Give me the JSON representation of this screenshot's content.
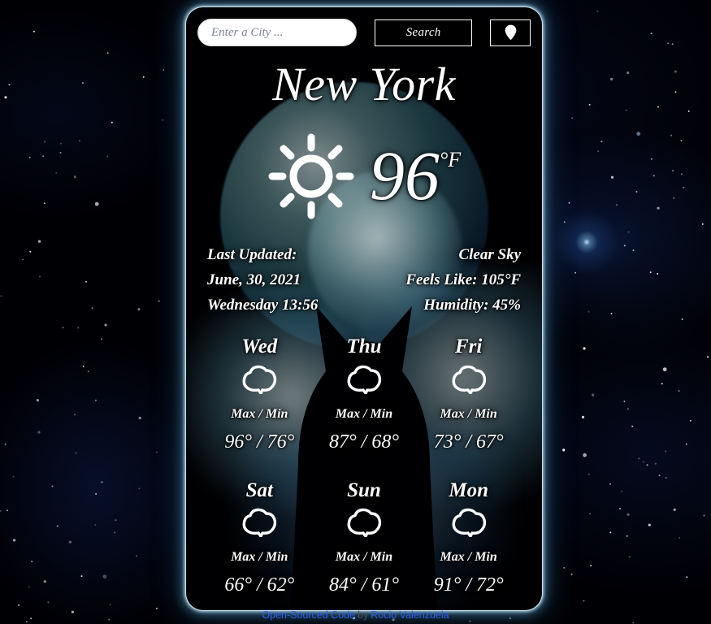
{
  "search": {
    "placeholder": "Enter a City ...",
    "value": "",
    "search_label": "Search",
    "location_icon": "map-pin-icon"
  },
  "current": {
    "city": "New York",
    "condition_icon": "sun-icon",
    "temperature": "96",
    "unit": "°F",
    "last_updated_label": "Last Updated:",
    "date": "June, 30, 2021",
    "weekday_time": "Wednesday 13:56",
    "description": "Clear Sky",
    "feels_like": "Feels Like: 105°F",
    "humidity": "Humidity: 45%"
  },
  "forecast": {
    "maxmin_label": "Max / Min",
    "days": [
      {
        "day": "Wed",
        "icon": "cloud-icon",
        "max": "96°",
        "min": "76°",
        "temps": "96° / 76°"
      },
      {
        "day": "Thu",
        "icon": "cloud-icon",
        "max": "87°",
        "min": "68°",
        "temps": "87° / 68°"
      },
      {
        "day": "Fri",
        "icon": "cloud-icon",
        "max": "73°",
        "min": "67°",
        "temps": "73° / 67°"
      },
      {
        "day": "Sat",
        "icon": "cloud-icon",
        "max": "66°",
        "min": "62°",
        "temps": "66° / 62°"
      },
      {
        "day": "Sun",
        "icon": "cloud-icon",
        "max": "84°",
        "min": "61°",
        "temps": "84° / 61°"
      },
      {
        "day": "Mon",
        "icon": "cloud-icon",
        "max": "91°",
        "min": "72°",
        "temps": "91° / 72°"
      }
    ]
  },
  "footer": {
    "code_link": "Open-Sourced Code",
    "by": "by",
    "author_link": "Rocio Valenzuela"
  },
  "colors": {
    "card_glow": "#bfeaff",
    "link": "#2b60f0",
    "text": "#ffffff",
    "background": "#000004"
  }
}
